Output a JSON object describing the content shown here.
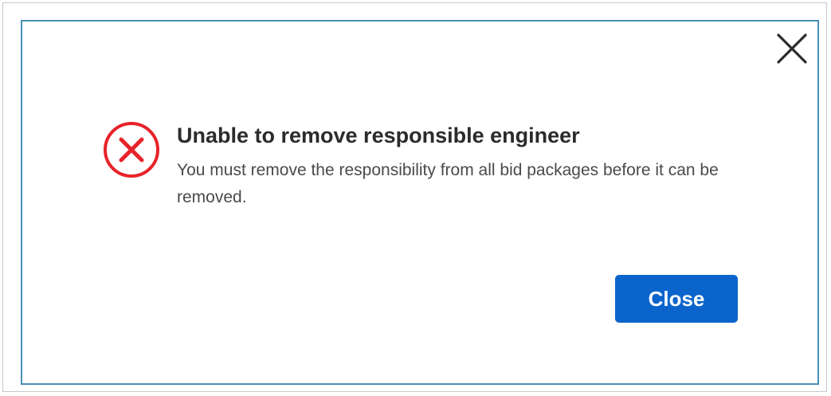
{
  "dialog": {
    "title": "Unable to remove responsible engineer",
    "message": "You must remove the responsibility from all bid packages before it can be removed.",
    "close_button_label": "Close",
    "icons": {
      "dismiss": "close-icon",
      "status": "error-icon"
    },
    "colors": {
      "error": "#e8232a",
      "primary_button": "#0a64cc",
      "modal_border": "#4a8fb5"
    }
  }
}
